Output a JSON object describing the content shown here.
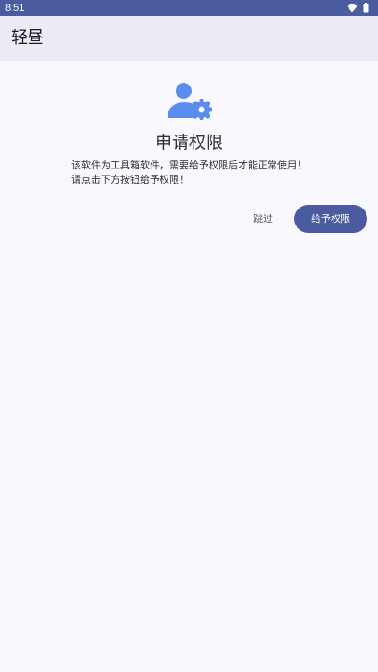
{
  "status_bar": {
    "time": "8:51",
    "icons": [
      "wifi-icon",
      "battery-icon"
    ]
  },
  "app_bar": {
    "title": "轻昼"
  },
  "permission": {
    "icon": "user-settings-icon",
    "title": "申请权限",
    "description_line1": "该软件为工具箱软件，需要给予权限后才能正常使用！",
    "description_line2": "请点击下方按钮给予权限！",
    "skip_label": "跳过",
    "grant_label": "给予权限"
  },
  "colors": {
    "primary": "#4a5ba0",
    "icon_blue": "#5b8def",
    "background": "#f9f8fe",
    "app_bar": "#edecf4"
  }
}
